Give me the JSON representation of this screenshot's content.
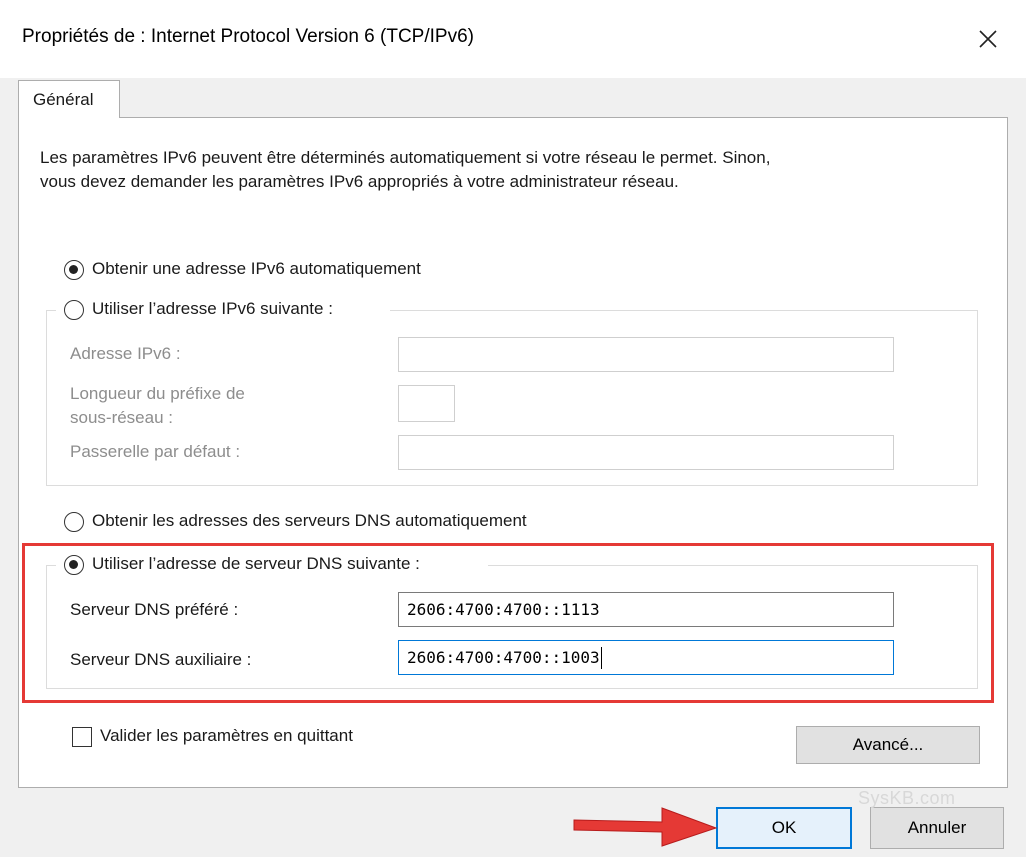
{
  "window": {
    "title": "Propriétés de : Internet Protocol Version 6 (TCP/IPv6)"
  },
  "tabs": [
    {
      "label": "Général",
      "active": true
    }
  ],
  "description": {
    "line1": "Les paramètres IPv6 peuvent être déterminés automatiquement si votre réseau le permet. Sinon,",
    "line2": "vous devez demander les paramètres IPv6 appropriés à votre administrateur réseau."
  },
  "ip_section": {
    "auto_label": "Obtenir une adresse IPv6 automatiquement",
    "auto_selected": true,
    "manual_label": "Utiliser l’adresse IPv6 suivante :",
    "manual_selected": false,
    "fields": {
      "address_label": "Adresse IPv6 :",
      "address_value": "",
      "prefix_label_line1": "Longueur du préfixe de",
      "prefix_label_line2": "sous-réseau :",
      "prefix_value": "",
      "gateway_label": "Passerelle par défaut :",
      "gateway_value": ""
    }
  },
  "dns_section": {
    "auto_label": "Obtenir les adresses des serveurs DNS automatiquement",
    "auto_selected": false,
    "manual_label": "Utiliser l’adresse de serveur DNS suivante :",
    "manual_selected": true,
    "preferred_label": "Serveur DNS préféré :",
    "preferred_value": "2606:4700:4700::1113",
    "alternate_label": "Serveur DNS auxiliaire :",
    "alternate_value": "2606:4700:4700::1003"
  },
  "validate": {
    "label": "Valider les paramètres en quittant",
    "checked": false
  },
  "buttons": {
    "advanced": "Avancé...",
    "ok": "OK",
    "cancel": "Annuler"
  },
  "watermark": "SysKB.com",
  "colors": {
    "highlight": "#e53935",
    "arrow": "#e53935",
    "focus": "#0078d7"
  },
  "icons": {
    "close": "close-icon",
    "arrow": "red-arrow-icon"
  }
}
